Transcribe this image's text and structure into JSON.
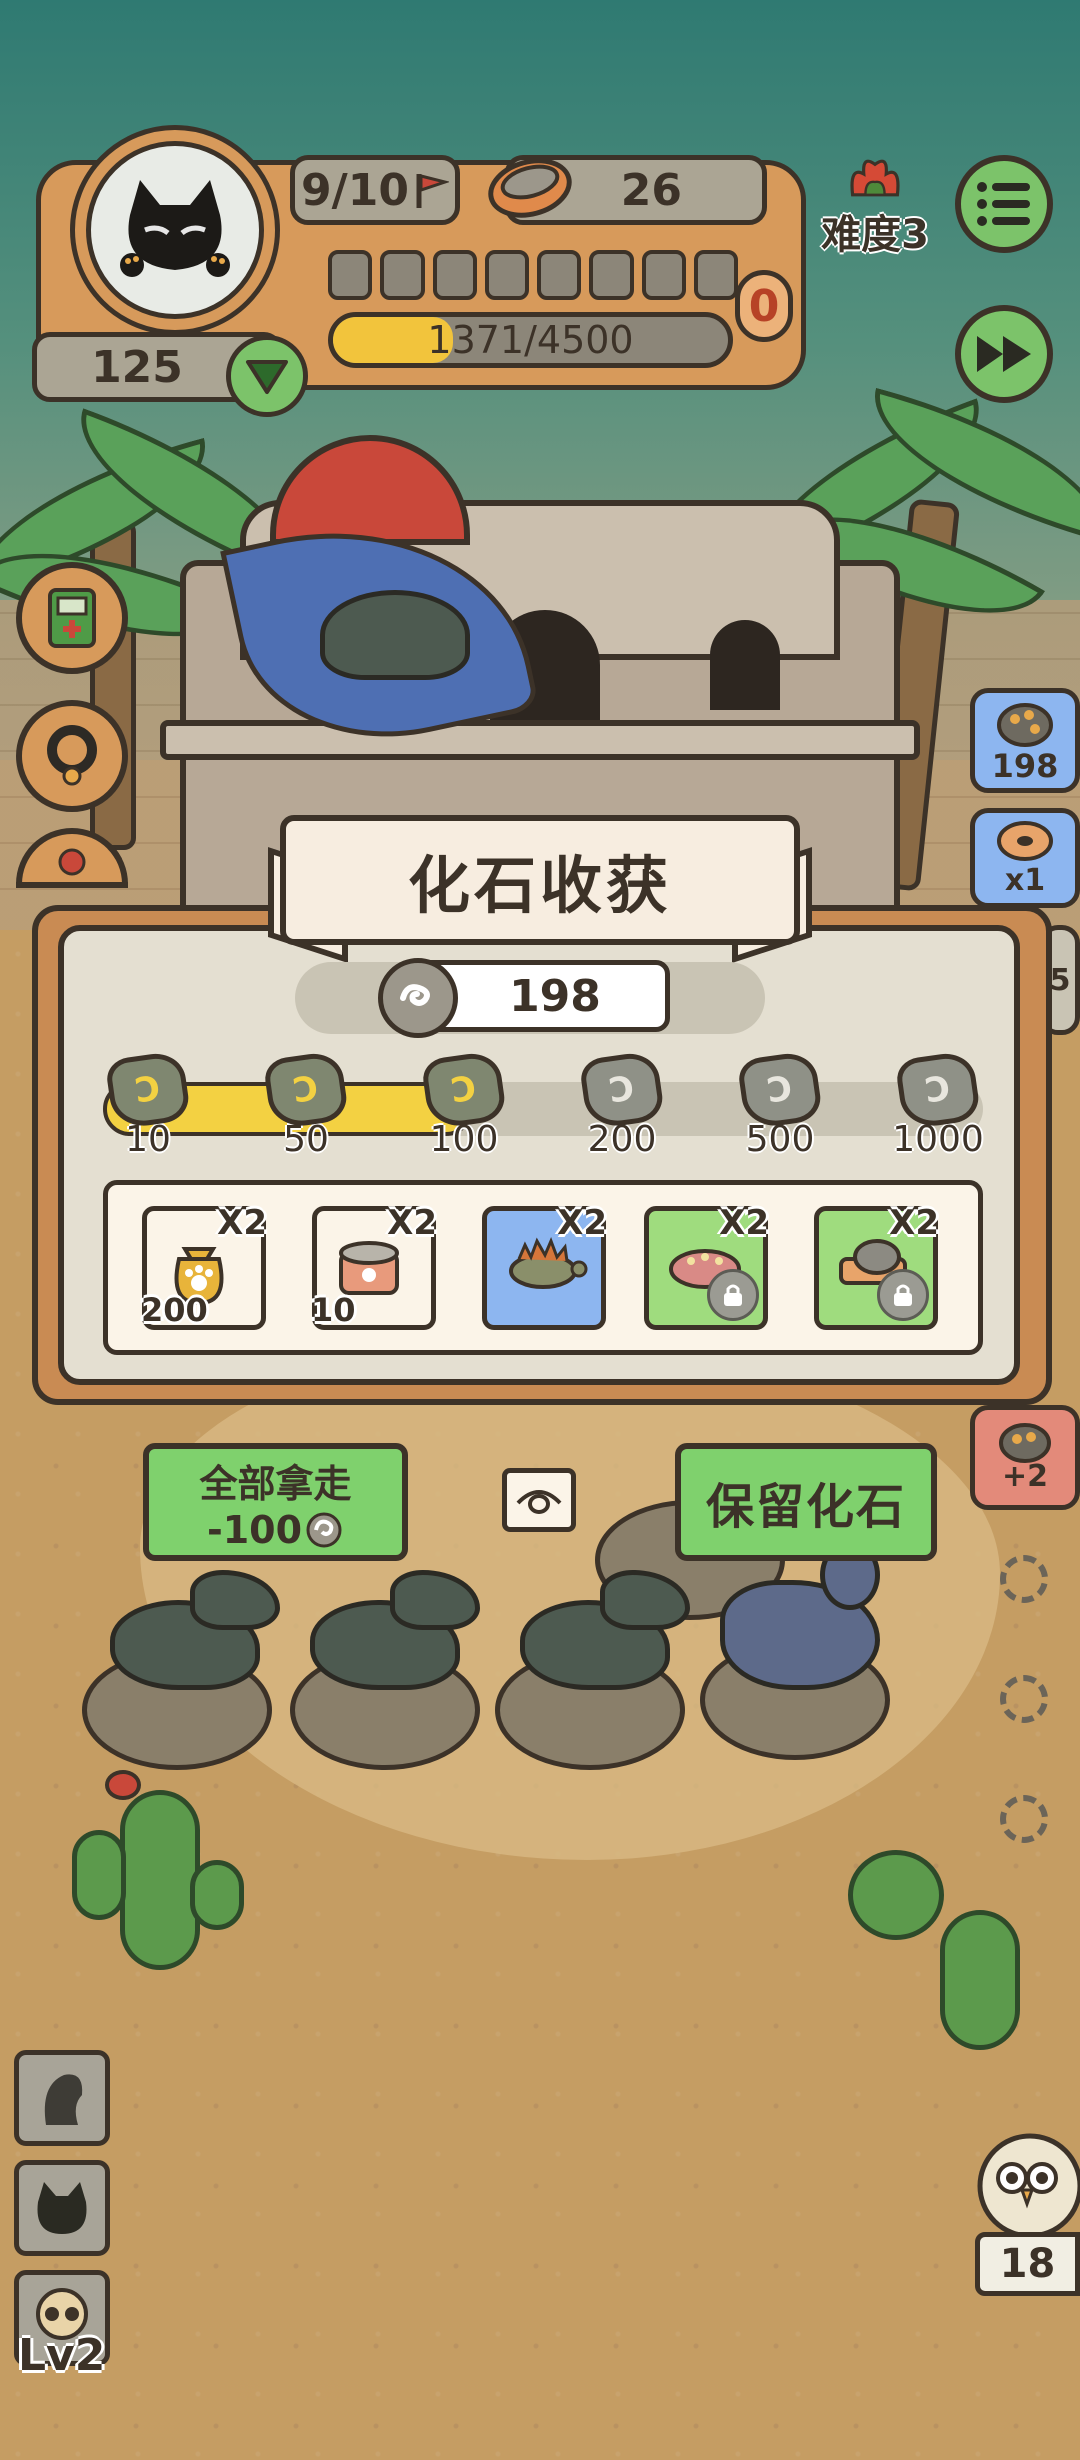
{
  "hud": {
    "wave": "9/10",
    "bowl_count": "26",
    "xp": {
      "text": "1371/4500",
      "current": 1371,
      "max": 4500
    },
    "energy_segments": 8,
    "zero_badge": "0",
    "hearts": "125",
    "difficulty": "难度3"
  },
  "dialog": {
    "title": "化石收获",
    "fossil_count": "198",
    "milestones": [
      {
        "label": "10",
        "reached": true
      },
      {
        "label": "50",
        "reached": true
      },
      {
        "label": "100",
        "reached": true
      },
      {
        "label": "200",
        "reached": false
      },
      {
        "label": "500",
        "reached": false
      },
      {
        "label": "1000",
        "reached": false
      }
    ],
    "progress_fraction": 0.42,
    "rewards": [
      {
        "name": "paw-coin-bag",
        "multiplier": "X2",
        "amount": "200",
        "locked": false,
        "bg": "#fbf4e8"
      },
      {
        "name": "food-can",
        "multiplier": "X2",
        "amount": "10",
        "locked": false,
        "bg": "#fbf4e8"
      },
      {
        "name": "stegosaurus",
        "multiplier": "X2",
        "amount": "",
        "locked": false,
        "bg": "#8db6f0"
      },
      {
        "name": "ankylosaurus",
        "multiplier": "X2",
        "amount": "",
        "locked": true,
        "bg": "#9fdc7e"
      },
      {
        "name": "fossil-tray",
        "multiplier": "X2",
        "amount": "",
        "locked": true,
        "bg": "#9fdc7e"
      }
    ]
  },
  "buttons": {
    "take_all_line1": "全部拿走",
    "take_all_line2": "-100",
    "keep": "保留化石"
  },
  "side": {
    "fossil_stash": "198",
    "donut_count": "x1",
    "fossil_bonus": "+2",
    "partial_5": "5"
  },
  "bottom": {
    "level": "Lv2",
    "owl_count": "18"
  },
  "colors": {
    "accent_green": "#7fd16d",
    "track_yellow": "#f3d142",
    "panel": "#e4dfd1",
    "frame_orange": "#c98b53"
  }
}
